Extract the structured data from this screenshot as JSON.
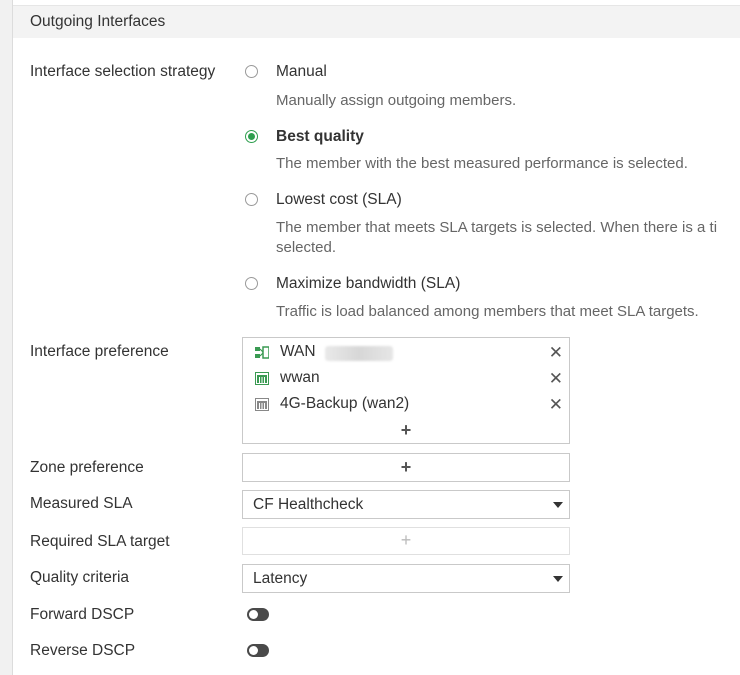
{
  "section": {
    "title": "Outgoing Interfaces"
  },
  "strategy": {
    "label": "Interface selection strategy",
    "options": [
      {
        "label": "Manual",
        "description": "Manually assign outgoing members.",
        "selected": false
      },
      {
        "label": "Best quality",
        "description": "The member with the best measured performance is selected.",
        "selected": true
      },
      {
        "label": "Lowest cost (SLA)",
        "description": "The member that meets SLA targets is selected. When there is a ti",
        "description2": "selected.",
        "selected": false
      },
      {
        "label": "Maximize bandwidth (SLA)",
        "description": "Traffic is load balanced among members that meet SLA targets.",
        "selected": false
      }
    ]
  },
  "interface_preference": {
    "label": "Interface preference",
    "items": [
      {
        "name": "WAN",
        "icon": "sdwan-interface-icon"
      },
      {
        "name": "wwan",
        "icon": "green-port-icon"
      },
      {
        "name": "4G-Backup (wan2)",
        "icon": "gray-port-icon"
      }
    ],
    "add": "+"
  },
  "zone_preference": {
    "label": "Zone preference",
    "add": "+"
  },
  "measured_sla": {
    "label": "Measured SLA",
    "value": "CF Healthcheck"
  },
  "required_sla": {
    "label": "Required SLA target",
    "add": "+"
  },
  "quality_criteria": {
    "label": "Quality criteria",
    "value": "Latency"
  },
  "forward_dscp": {
    "label": "Forward DSCP",
    "enabled": false
  },
  "reverse_dscp": {
    "label": "Reverse DSCP",
    "enabled": false
  },
  "colors": {
    "accent": "#2e9e4e",
    "toggle_off": "#4a4a4a"
  }
}
